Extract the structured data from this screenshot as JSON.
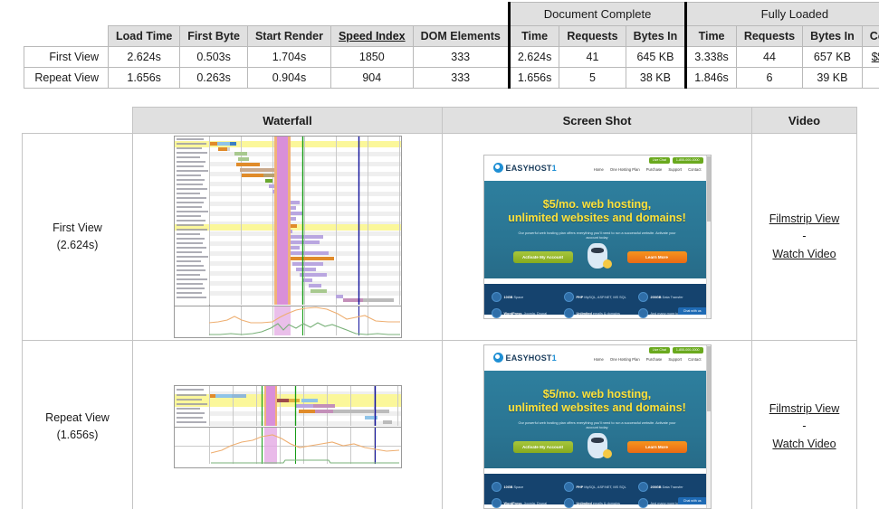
{
  "summary_table": {
    "group_headers": [
      {
        "label": "Document Complete",
        "span": 3
      },
      {
        "label": "Fully Loaded",
        "span": 3
      }
    ],
    "columns": [
      "Load Time",
      "First Byte",
      "Start Render",
      "Speed Index",
      "DOM Elements",
      "Time",
      "Requests",
      "Bytes In",
      "Time",
      "Requests",
      "Bytes In",
      "Cost"
    ],
    "speed_index_is_link": true,
    "rows": [
      {
        "label": "First View",
        "load_time": "2.624s",
        "first_byte": "0.503s",
        "start_render": "1.704s",
        "speed_index": "1850",
        "dom_elements": "333",
        "doc_time": "2.624s",
        "doc_requests": "41",
        "doc_bytes_in": "645 KB",
        "full_time": "3.338s",
        "full_requests": "44",
        "full_bytes_in": "657 KB",
        "cost": "$$---"
      },
      {
        "label": "Repeat View",
        "load_time": "1.656s",
        "first_byte": "0.263s",
        "start_render": "0.904s",
        "speed_index": "904",
        "dom_elements": "333",
        "doc_time": "1.656s",
        "doc_requests": "5",
        "doc_bytes_in": "38 KB",
        "full_time": "1.846s",
        "full_requests": "6",
        "full_bytes_in": "39 KB",
        "cost": ""
      }
    ]
  },
  "detail_table": {
    "headers": {
      "waterfall": "Waterfall",
      "screenshot": "Screen Shot",
      "video": "Video"
    },
    "rows": [
      {
        "view_name": "First View",
        "view_time": "(2.624s)",
        "video": {
          "filmstrip_label": "Filmstrip View",
          "separator": "-",
          "watch_label": "Watch Video"
        }
      },
      {
        "view_name": "Repeat View",
        "view_time": "(1.656s)",
        "video": {
          "filmstrip_label": "Filmstrip View",
          "separator": "-",
          "watch_label": "Watch Video"
        }
      }
    ]
  },
  "screenshot_content": {
    "brand_name": "EASYHOST",
    "brand_suffix": "1",
    "badges": [
      "Live Chat",
      "1-855-000-0000"
    ],
    "nav_items": [
      "Home",
      "One Hosting Plan",
      "Purchase",
      "Support",
      "Contact"
    ],
    "hero_line1": "$5/mo. web hosting,",
    "hero_line2": "unlimited websites and domains!",
    "hero_sub": "Our powerful web hosting plan offers everything you'll need to run a successful website. Activate your account today",
    "cta_primary": "Activate My Account",
    "cta_secondary": "Learn More",
    "features": [
      {
        "bold": "10GB",
        "rest": "Space"
      },
      {
        "bold": "PHP",
        "rest": "MySQL, ASP.NET, MS SQL"
      },
      {
        "bold": "200GB",
        "rest": "Data Transfer"
      },
      {
        "bold": "WordPress",
        "rest": ", Joomla, Drupal"
      },
      {
        "bold": "Unlimited",
        "rest": "emails & domains"
      },
      {
        "bold": "",
        "rest": "And many more tools supported"
      }
    ],
    "chat_label": "Chat with us"
  },
  "colors": {
    "header_bg": "#e0e0e0",
    "border": "#b9b9b9",
    "waterfall_band": "#d98fd9",
    "start_render_line": "#169b16",
    "doc_complete_line": "#11119c",
    "highlight_row": "#fbf79a",
    "hero_heading": "#fde23b",
    "hero_bg": "#2a7593",
    "features_bg": "#15436e",
    "cta_green": "#86ab1f",
    "cta_orange": "#ea6a14"
  }
}
